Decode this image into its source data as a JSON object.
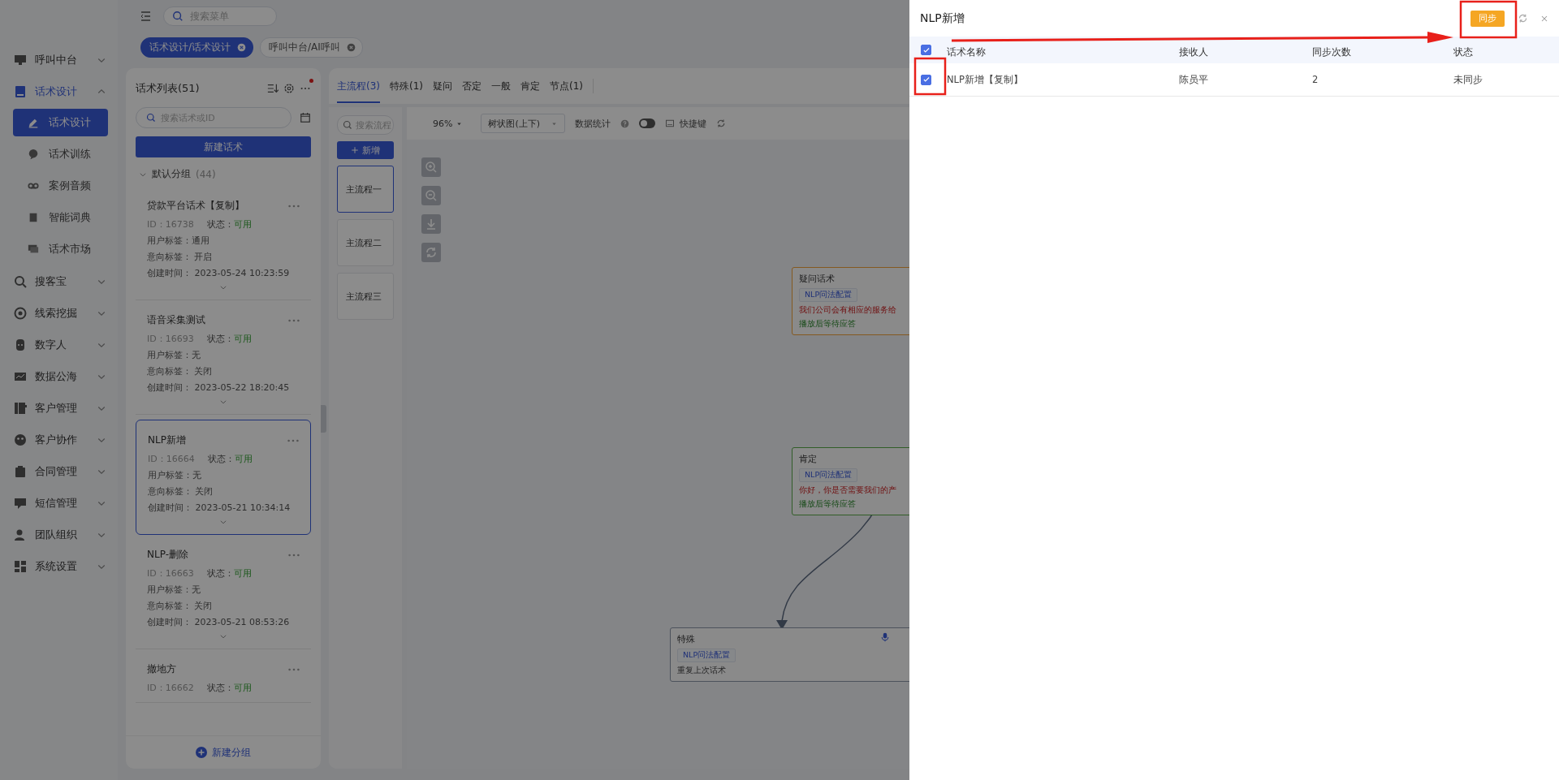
{
  "top_bar": {
    "search_placeholder": "搜索菜单"
  },
  "tabs": [
    {
      "label": "话术设计/话术设计",
      "selected": true
    },
    {
      "label": "呼叫中台/AI呼叫",
      "selected": false
    }
  ],
  "sidebar": {
    "items": [
      {
        "label": "呼叫中台",
        "expanded": false
      },
      {
        "label": "话术设计",
        "expanded": true,
        "children": [
          {
            "label": "话术设计",
            "selected": true
          },
          {
            "label": "话术训练",
            "selected": false
          },
          {
            "label": "案例音频",
            "selected": false
          },
          {
            "label": "智能词典",
            "selected": false
          },
          {
            "label": "话术市场",
            "selected": false
          }
        ]
      },
      {
        "label": "搜客宝",
        "expanded": false
      },
      {
        "label": "线索挖掘",
        "expanded": false
      },
      {
        "label": "数字人",
        "expanded": false
      },
      {
        "label": "数据公海",
        "expanded": false
      },
      {
        "label": "客户管理",
        "expanded": false
      },
      {
        "label": "客户协作",
        "expanded": false
      },
      {
        "label": "合同管理",
        "expanded": false
      },
      {
        "label": "短信管理",
        "expanded": false
      },
      {
        "label": "团队组织",
        "expanded": false
      },
      {
        "label": "系统设置",
        "expanded": false
      }
    ]
  },
  "script_list": {
    "title": "话术列表(51)",
    "search_placeholder": "搜索话术或ID",
    "new_button": "新建话术",
    "group": {
      "label": "默认分组",
      "count": "(44)",
      "expanded": true
    },
    "cards": [
      {
        "title": "贷款平台话术【复制】",
        "id": "ID：16738",
        "status_label": "状态：",
        "status": "可用",
        "user_tag": "用户标签：通用",
        "intent_tag": "意向标签：  开启",
        "created": "创建时间：  2023-05-24 10:23:59",
        "selected": false
      },
      {
        "title": "语音采集测试",
        "id": "ID：16693",
        "status_label": "状态：",
        "status": "可用",
        "user_tag": "用户标签：无",
        "intent_tag": "意向标签：  关闭",
        "created": "创建时间：  2023-05-22 18:20:45",
        "selected": false
      },
      {
        "title": "NLP新增",
        "id": "ID：16664",
        "status_label": "状态：",
        "status": "可用",
        "user_tag": "用户标签：无",
        "intent_tag": "意向标签：  关闭",
        "created": "创建时间：  2023-05-21 10:34:14",
        "selected": true
      },
      {
        "title": "NLP-删除",
        "id": "ID：16663",
        "status_label": "状态：",
        "status": "可用",
        "user_tag": "用户标签：无",
        "intent_tag": "意向标签：  关闭",
        "created": "创建时间：  2023-05-21 08:53:26",
        "selected": false
      },
      {
        "title": "撤地方",
        "id": "ID：16662",
        "status_label": "状态：",
        "status": "可用",
        "selected": false
      }
    ],
    "new_group_button": "新建分组"
  },
  "flow_tabs": [
    {
      "label": "主流程(3)",
      "selected": true
    },
    {
      "label": "特殊(1)",
      "selected": false
    },
    {
      "label": "疑问",
      "selected": false
    },
    {
      "label": "否定",
      "selected": false
    },
    {
      "label": "一般",
      "selected": false
    },
    {
      "label": "肯定",
      "selected": false
    },
    {
      "label": "节点(1)",
      "selected": false
    }
  ],
  "flows": {
    "search_placeholder": "搜索流程",
    "add_button": "新增",
    "items": [
      {
        "label": "主流程一",
        "selected": true
      },
      {
        "label": "主流程二",
        "selected": false
      },
      {
        "label": "主流程三",
        "selected": false
      }
    ]
  },
  "toolbar": {
    "zoom": "96%",
    "layout": "树状图(上下)",
    "stats_label": "数据统计",
    "stats_on": false,
    "shortcut": "快捷键"
  },
  "nodes": [
    {
      "kind": "question",
      "title": "疑问话术",
      "tag": "NLP问法配置",
      "text": "我们公司会有相应的服务给",
      "action": "播放后等待应答"
    },
    {
      "kind": "positive",
      "title": "肯定",
      "tag": "NLP问法配置",
      "text": "你好，你是否需要我们的产",
      "action": "播放后等待应答"
    },
    {
      "kind": "special",
      "title": "特殊",
      "tag": "NLP问法配置",
      "action": "重复上次话术"
    }
  ],
  "drawer": {
    "title": "NLP新增",
    "sync_button": "同步",
    "columns": [
      "话术名称",
      "接收人",
      "同步次数",
      "状态"
    ],
    "all_checked": true,
    "rows": [
      {
        "checked": true,
        "cells": [
          "NLP新增【复制】",
          "陈员平",
          "2",
          "未同步"
        ]
      }
    ]
  }
}
